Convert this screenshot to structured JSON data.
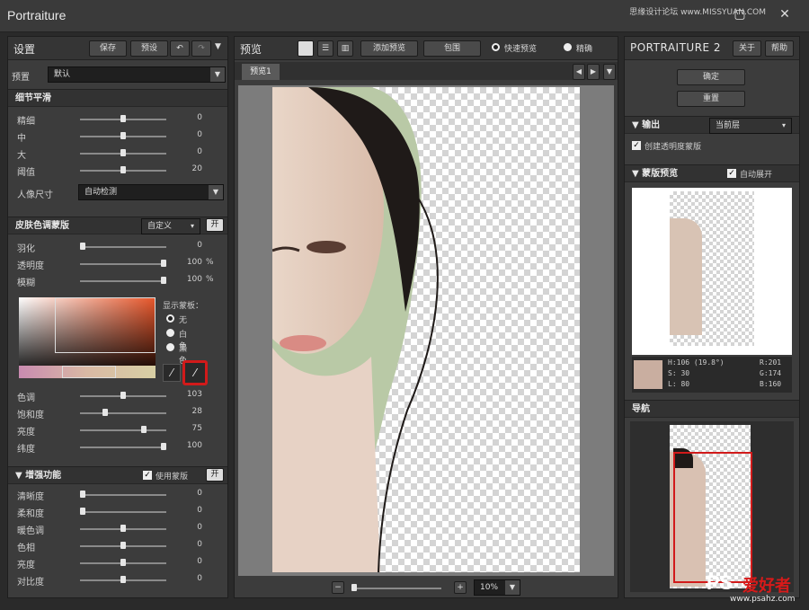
{
  "window": {
    "title": "Portraiture",
    "watermark": "思缘设计论坛 www.MISSYUAN.COM"
  },
  "left": {
    "title": "设置",
    "save": "保存",
    "preset": "预设",
    "preset_label": "预置",
    "preset_value": "默认",
    "detail": {
      "title": "细节平滑",
      "rows": [
        {
          "label": "精细",
          "value": "0",
          "pct": 0.5
        },
        {
          "label": "中",
          "value": "0",
          "pct": 0.5
        },
        {
          "label": "大",
          "value": "0",
          "pct": 0.5
        },
        {
          "label": "阈值",
          "value": "20",
          "pct": 0.5
        }
      ],
      "portrait_label": "人像尺寸",
      "portrait_value": "自动检测"
    },
    "skin": {
      "title": "皮肤色调蒙版",
      "mode": "自定义",
      "on": "开",
      "rows": [
        {
          "label": "羽化",
          "value": "0",
          "unit": "",
          "pct": 0.0
        },
        {
          "label": "透明度",
          "value": "100",
          "unit": "%",
          "pct": 1.0
        },
        {
          "label": "模糊",
          "value": "100",
          "unit": "%",
          "pct": 1.0
        }
      ],
      "show_mask": "显示蒙板：",
      "options": [
        "无",
        "白色",
        "黑色"
      ],
      "selected_option": "无",
      "rows2": [
        {
          "label": "色调",
          "value": "103",
          "pct": 0.5
        },
        {
          "label": "饱和度",
          "value": "28",
          "pct": 0.28
        },
        {
          "label": "亮度",
          "value": "75",
          "pct": 0.75
        },
        {
          "label": "纬度",
          "value": "100",
          "pct": 1.0
        }
      ]
    },
    "enhance": {
      "title": "增强功能",
      "use_mask": "使用蒙版",
      "on": "开",
      "rows": [
        {
          "label": "清晰度",
          "value": "0",
          "pct": 0.0
        },
        {
          "label": "柔和度",
          "value": "0",
          "pct": 0.0
        },
        {
          "label": "暖色调",
          "value": "0",
          "pct": 0.5
        },
        {
          "label": "色相",
          "value": "0",
          "pct": 0.5
        },
        {
          "label": "亮度",
          "value": "0",
          "pct": 0.5
        },
        {
          "label": "对比度",
          "value": "0",
          "pct": 0.5
        }
      ]
    }
  },
  "center": {
    "title": "预览",
    "add_preview": "添加预览",
    "color_pick": "包围",
    "fast_preview": "快速预览",
    "accurate": "精确",
    "tab": "预览1",
    "zoom": "10%"
  },
  "right": {
    "brand": "PORTRAITURE 2",
    "about": "关于",
    "help": "帮助",
    "ok": "确定",
    "reset": "重置",
    "output": "输出",
    "output_value": "当前层",
    "create_mask": "创建透明度蒙版",
    "mask_preview": "蒙版预览",
    "auto_expand": "自动展开",
    "hsl": {
      "h": "H:106 (19.8°)",
      "s": "S: 30",
      "l": "L: 80"
    },
    "rgb": {
      "r": "R:201",
      "g": "G:174",
      "b": "B:160"
    },
    "swatch_color": "#c9aea0",
    "navigation": "导航"
  },
  "watermark": {
    "logo": "PS",
    "text": "爱好者",
    "url": "www.psahz.com"
  },
  "colors": {
    "accent_red": "#d11a1a",
    "panel": "#3c3c3c"
  }
}
